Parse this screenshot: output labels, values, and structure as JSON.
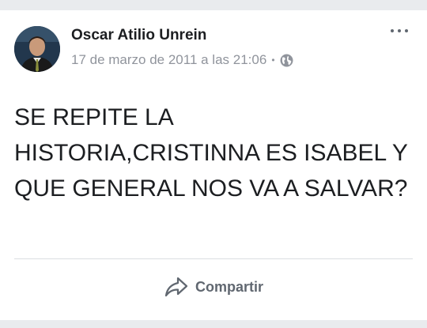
{
  "post": {
    "author": "Oscar Atilio Unrein",
    "timestamp": "17 de marzo de 2011 a las 21:06",
    "separator": "•",
    "privacy_icon": "globe-icon",
    "text": "SE REPITE LA HISTORIA,CRISTINNA ES ISABEL Y QUE GENERAL NOS VA A SALVAR?"
  },
  "actions": {
    "share_label": "Compartir",
    "share_icon": "share-arrow-icon",
    "more_icon": "more-options-icon"
  },
  "colors": {
    "background": "#e9ebee",
    "card": "#ffffff",
    "text": "#1c1e21",
    "secondary": "#90949c",
    "action": "#606770"
  }
}
